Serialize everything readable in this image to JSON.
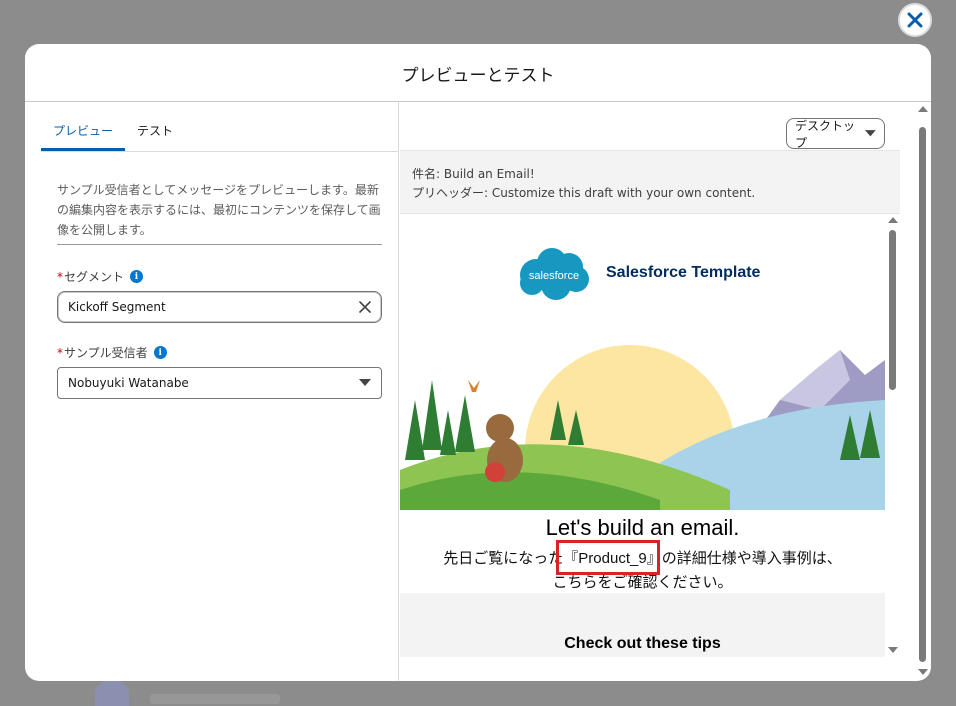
{
  "modal": {
    "title": "プレビューとテスト"
  },
  "tabs": [
    {
      "label": "プレビュー",
      "active": true
    },
    {
      "label": "テスト",
      "active": false
    }
  ],
  "description": "サンプル受信者としてメッセージをプレビューします。最新の編集内容を表示するには、最初にコンテンツを保存して画像を公開します。",
  "segment": {
    "required_mark": "*",
    "label": "セグメント",
    "value": "Kickoff Segment"
  },
  "recipient": {
    "required_mark": "*",
    "label": "サンプル受信者",
    "value": "Nobuyuki Watanabe"
  },
  "device": {
    "selected": "デスクトップ"
  },
  "meta": {
    "subject_label": "件名:",
    "subject": "Build an Email!",
    "preheader_label": "プリヘッダー:",
    "preheader": "Customize this draft with your own content."
  },
  "email": {
    "logo_word": "salesforce",
    "template_name": "Salesforce Template",
    "heading": "Let's build an email.",
    "line1_before": "先日ご覧になった",
    "product": "『Product_9』",
    "line1_after": "の詳細仕様や導入事例は、",
    "line2": "こちらをご確認ください。",
    "tips_title": "Check out these tips"
  },
  "colors": {
    "accent": "#0b5cab",
    "required": "#ba0517",
    "highlight": "#d8232a",
    "salesforce_blue": "#1798c1"
  }
}
